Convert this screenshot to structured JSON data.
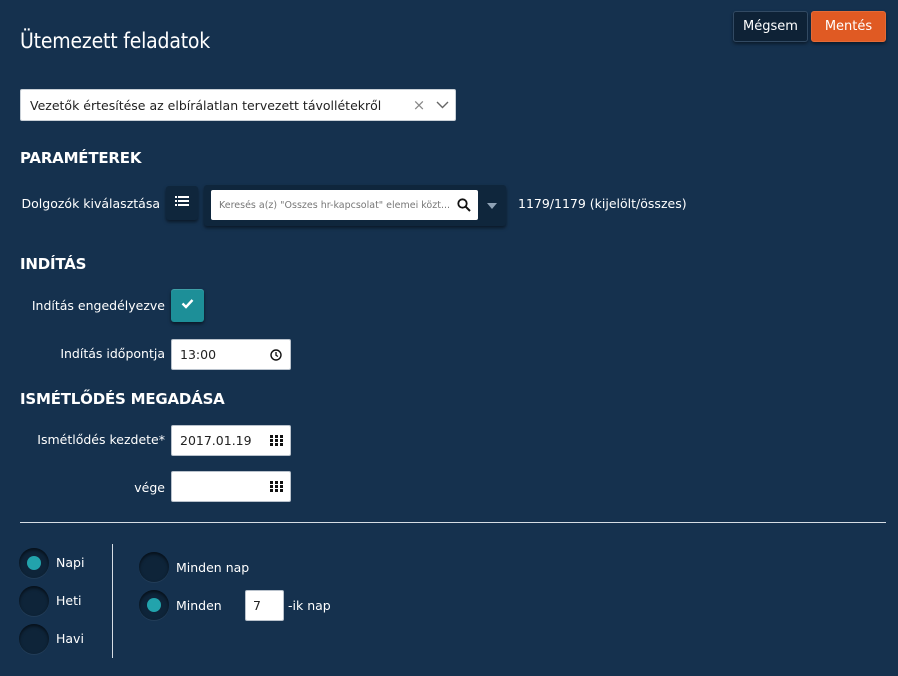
{
  "header": {
    "title": "Ütemezett feladatok",
    "cancel_label": "Mégsem",
    "save_label": "Mentés"
  },
  "task_select": {
    "value": "Vezetők értesítése az elbírálatlan tervezett távollétekről",
    "clear_glyph": "×"
  },
  "parameters": {
    "section_title": "PARAMÉTEREK",
    "employees_label": "Dolgozók kiválasztása",
    "search_placeholder": "Keresés a(z) \"Összes hr-kapcsolat\" elemei közt...",
    "count_text": "1179/1179 (kijelölt/összes)"
  },
  "start": {
    "section_title": "INDÍTÁS",
    "enabled_label": "Indítás engedélyezve",
    "enabled": true,
    "time_label": "Indítás időpontja",
    "time_value": "13:00"
  },
  "recurrence": {
    "section_title": "ISMÉTLŐDÉS MEGADÁSA",
    "start_label": "Ismétlődés kezdete*",
    "start_value": "2017.01.19",
    "end_label": "vége",
    "end_value": "",
    "frequency": [
      {
        "label": "Napi",
        "selected": true
      },
      {
        "label": "Heti",
        "selected": false
      },
      {
        "label": "Havi",
        "selected": false
      }
    ],
    "daily_options": {
      "every_day_label": "Minden nap",
      "every_day_selected": false,
      "every_n_label": "Minden",
      "every_n_selected": true,
      "every_n_value": "7",
      "every_n_suffix": "-ik nap"
    }
  },
  "colors": {
    "background": "#15314e",
    "accent_teal": "#22a3ac",
    "save_orange": "#e05a23"
  },
  "icons": {
    "list": "list-icon",
    "search": "search-icon",
    "clock": "clock-icon",
    "calendar": "calendar-icon",
    "check": "check-icon",
    "chevron": "chevron-down-icon"
  }
}
